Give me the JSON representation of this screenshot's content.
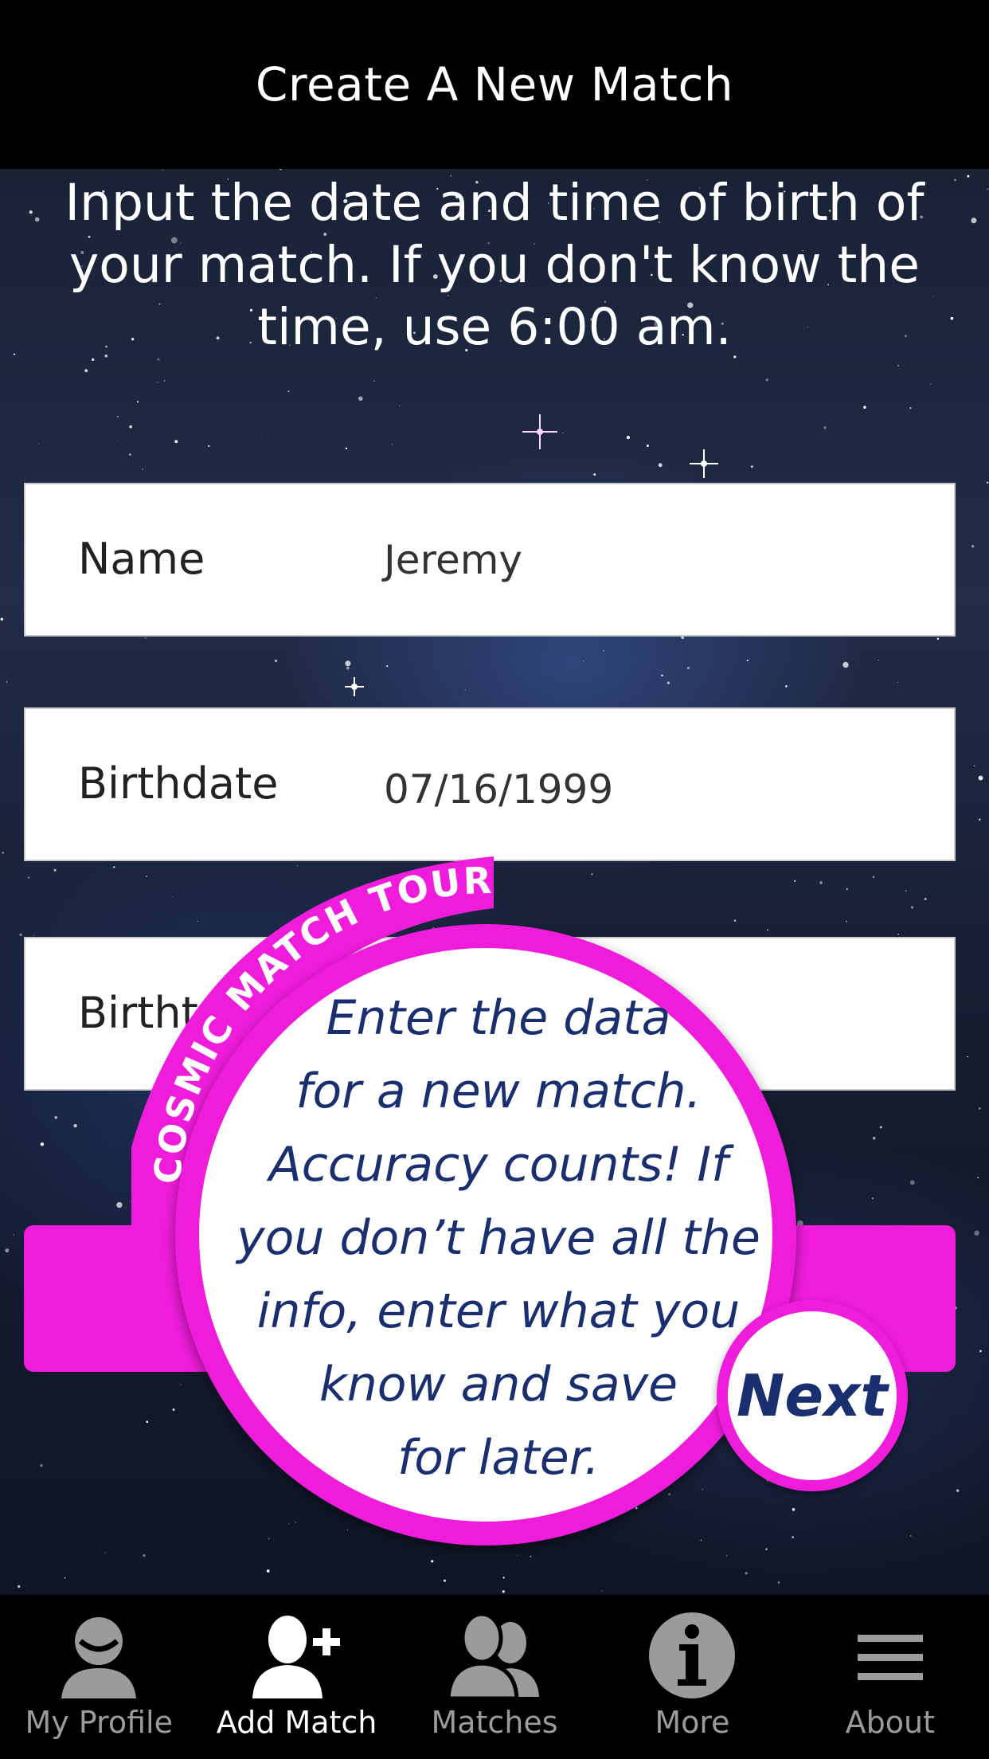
{
  "header": {
    "title": "Create A New Match"
  },
  "instruction": "Input the date and time of birth of your match. If you don't know the time, use 6:00 am.",
  "form": {
    "name_label": "Name",
    "name_value": "Jeremy",
    "birthdate_label": "Birthdate",
    "birthdate_value": "07/16/1999",
    "birthtime_label": "Birtht"
  },
  "tour": {
    "banner": "COSMIC MATCH TOUR",
    "message_lines": [
      "Enter the data",
      "for a new match.",
      "Accuracy counts! If",
      "you don’t have all the",
      "info, enter what you",
      "know and save",
      "for later."
    ],
    "next_label": "Next"
  },
  "tabs": [
    {
      "label": "My Profile",
      "icon": "profile-icon",
      "active": false
    },
    {
      "label": "Add Match",
      "icon": "add-user-icon",
      "active": true
    },
    {
      "label": "Matches",
      "icon": "users-icon",
      "active": false
    },
    {
      "label": "More",
      "icon": "info-icon",
      "active": false
    },
    {
      "label": "About",
      "icon": "menu-icon",
      "active": false
    }
  ],
  "colors": {
    "accent": "#f01cdc",
    "tour_text": "#1a2f70",
    "tab_active": "#ffffff",
    "tab_inactive": "#9b9b9b"
  }
}
